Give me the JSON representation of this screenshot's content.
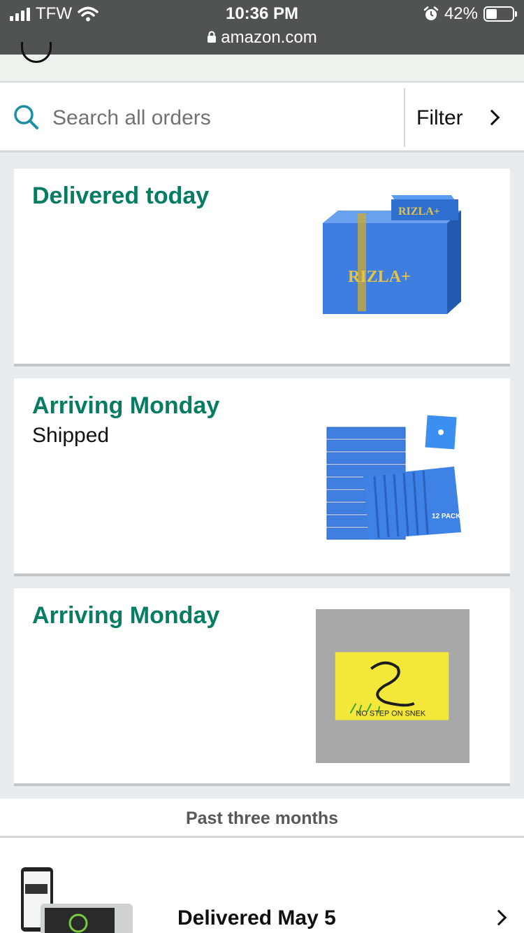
{
  "status_bar": {
    "carrier": "TFW",
    "time": "10:36 PM",
    "url": "amazon.com",
    "battery": "42%",
    "battery_level": 0.42
  },
  "search": {
    "placeholder": "Search all orders",
    "filter_label": "Filter"
  },
  "orders": [
    {
      "status": "Delivered today",
      "sub": "",
      "image_desc_icon": "cigarette-papers-box"
    },
    {
      "status": "Arriving Monday",
      "sub": "Shipped",
      "image_desc_icon": "acoustic-foam-panels"
    },
    {
      "status": "Arriving Monday",
      "sub": "",
      "image_desc_icon": "flag-sticker",
      "sticker_text": "NO STEP ON SNEK"
    }
  ],
  "rizla_text": "RIZLA+",
  "foam_pack": "12 PACK",
  "past_section": {
    "title": "Past three months",
    "items": [
      {
        "status": "Delivered May 5"
      }
    ]
  },
  "colors": {
    "accent": "#067d62",
    "status_bar": "#4f5452"
  }
}
